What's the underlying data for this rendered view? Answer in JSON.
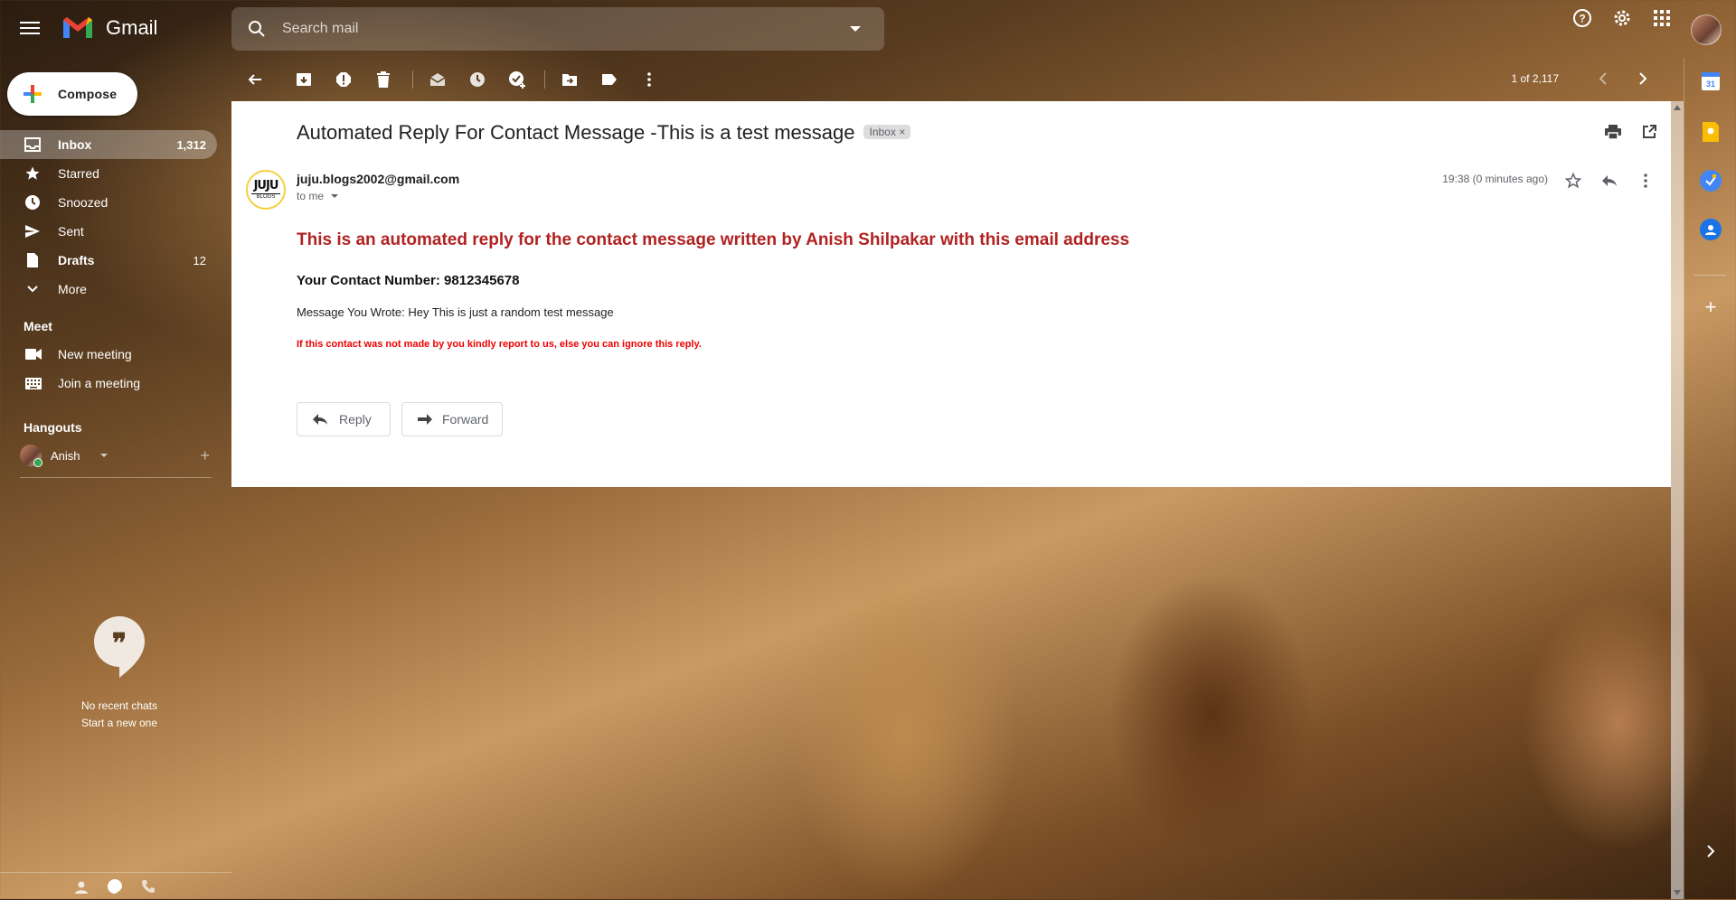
{
  "app": {
    "name": "Gmail"
  },
  "search": {
    "placeholder": "Search mail"
  },
  "compose": {
    "label": "Compose"
  },
  "nav": {
    "items": [
      {
        "label": "Inbox",
        "count": "1,312"
      },
      {
        "label": "Starred",
        "count": ""
      },
      {
        "label": "Snoozed",
        "count": ""
      },
      {
        "label": "Sent",
        "count": ""
      },
      {
        "label": "Drafts",
        "count": "12"
      },
      {
        "label": "More",
        "count": ""
      }
    ]
  },
  "meet": {
    "title": "Meet",
    "new_meeting": "New meeting",
    "join_meeting": "Join a meeting"
  },
  "hangouts": {
    "title": "Hangouts",
    "user": "Anish",
    "no_recent": "No recent chats",
    "start_new": "Start a new one"
  },
  "pager": {
    "text": "1 of 2,117"
  },
  "email": {
    "subject": "Automated Reply For Contact Message -This is a test message",
    "label_chip": "Inbox",
    "sender": "juju.blogs2002@gmail.com",
    "avatar_text": "JUJU",
    "avatar_sub": "BLOGS",
    "to": "to me",
    "time": "19:38 (0 minutes ago)",
    "heading": "This is an automated reply for the contact message written by Anish Shilpakar with this email address",
    "contact": "Your Contact Number: 9812345678",
    "message": "Message You Wrote: Hey This is just a random test message",
    "warning": "If this contact was not made by you kindly report to us, else you can ignore this reply.",
    "reply_label": "Reply",
    "forward_label": "Forward"
  },
  "colors": {
    "heading_red": "#b22222",
    "warning_red": "#ee0000",
    "online_green": "#34a853"
  }
}
